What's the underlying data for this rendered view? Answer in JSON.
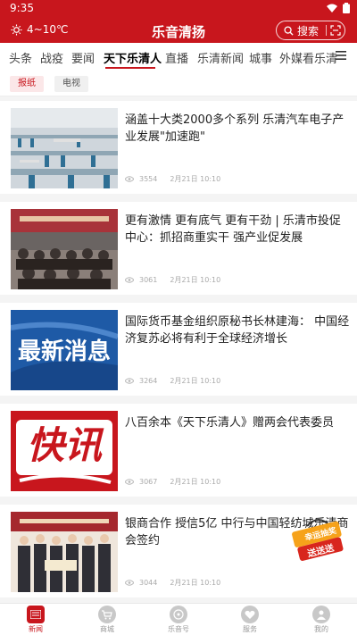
{
  "status_bar": {
    "time": "9:35"
  },
  "header": {
    "weather": "4~10℃",
    "title": "乐音清扬",
    "search_label": "搜索",
    "brand_color": "#c8161d"
  },
  "category_tabs": [
    {
      "label": "头条",
      "active": false
    },
    {
      "label": "战疫",
      "active": false
    },
    {
      "label": "要闻",
      "active": false
    },
    {
      "label": "天下乐清人",
      "active": true
    },
    {
      "label": "直播",
      "active": false
    },
    {
      "label": "乐清新闻",
      "active": false
    },
    {
      "label": "城事",
      "active": false
    },
    {
      "label": "外媒看乐清",
      "active": false
    }
  ],
  "sub_tabs": [
    {
      "label": "报纸",
      "active": true
    },
    {
      "label": "电视",
      "active": false
    }
  ],
  "articles": [
    {
      "title": "涵盖十大类2000多个系列 乐清汽车电子产业发展\"加速跑\"",
      "views": "3554",
      "date": "2月21日 10:10",
      "thumb": "factory-photo"
    },
    {
      "title": "更有激情 更有底气 更有干劲 | 乐清市投促中心：抓招商重实干 强产业促发展",
      "views": "3061",
      "date": "2月21日 10:10",
      "thumb": "meeting-photo"
    },
    {
      "title": "国际货币基金组织原秘书长林建海： 中国经济复苏必将有利于全球经济增长",
      "views": "3264",
      "date": "2月21日 10:10",
      "thumb": "latest-news-graphic",
      "thumb_text": "最新消息"
    },
    {
      "title": "八百余本《天下乐清人》赠两会代表委员",
      "views": "3067",
      "date": "2月21日 10:10",
      "thumb": "flash-news-graphic",
      "thumb_text": "快讯"
    },
    {
      "title": "银商合作 授信5亿 中行与中国轻纺城乐清商会签约",
      "views": "3044",
      "date": "2月21日 10:10",
      "thumb": "signing-photo"
    }
  ],
  "promo_badge": {
    "line1": "幸运抽奖",
    "line2": "送送送"
  },
  "bottom_nav": [
    {
      "label": "新闻",
      "icon": "news-icon",
      "active": true
    },
    {
      "label": "商城",
      "icon": "shopping-cart-icon",
      "active": false
    },
    {
      "label": "乐音号",
      "icon": "music-disc-icon",
      "active": false
    },
    {
      "label": "服务",
      "icon": "heart-service-icon",
      "active": false
    },
    {
      "label": "我的",
      "icon": "profile-icon",
      "active": false
    }
  ]
}
